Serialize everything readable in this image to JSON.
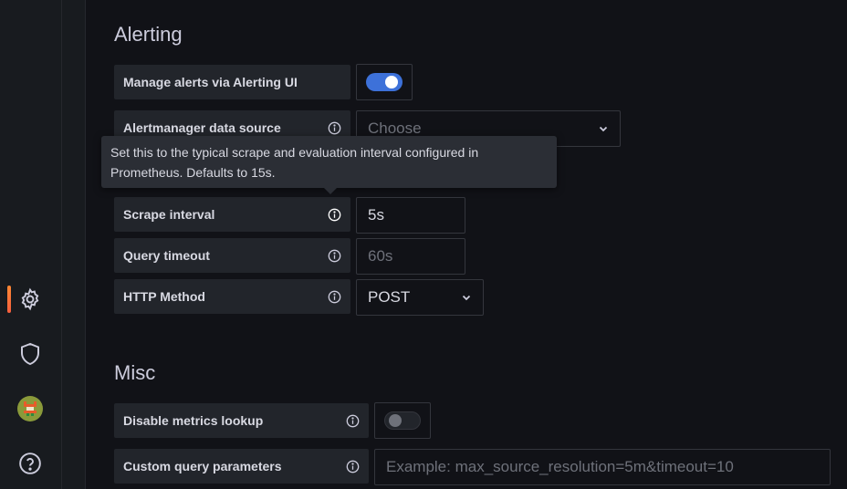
{
  "sidebar": {
    "icons": [
      "gear-icon",
      "shield-icon",
      "avatar",
      "help-icon"
    ]
  },
  "alerting": {
    "title": "Alerting",
    "manage_alerts_label": "Manage alerts via Alerting UI",
    "manage_alerts_enabled": true,
    "alertmanager_label": "Alertmanager data source",
    "alertmanager_placeholder": "Choose",
    "tooltip_text": "Set this to the typical scrape and evaluation interval configured in Prometheus. Defaults to 15s.",
    "scrape_interval_label": "Scrape interval",
    "scrape_interval_value": "5s",
    "query_timeout_label": "Query timeout",
    "query_timeout_placeholder": "60s",
    "http_method_label": "HTTP Method",
    "http_method_value": "POST"
  },
  "misc": {
    "title": "Misc",
    "disable_metrics_label": "Disable metrics lookup",
    "disable_metrics_enabled": false,
    "custom_query_label": "Custom query parameters",
    "custom_query_placeholder": "Example: max_source_resolution=5m&timeout=10"
  },
  "colors": {
    "accent": "#3d71d9",
    "active_bar": "#ff8833"
  }
}
